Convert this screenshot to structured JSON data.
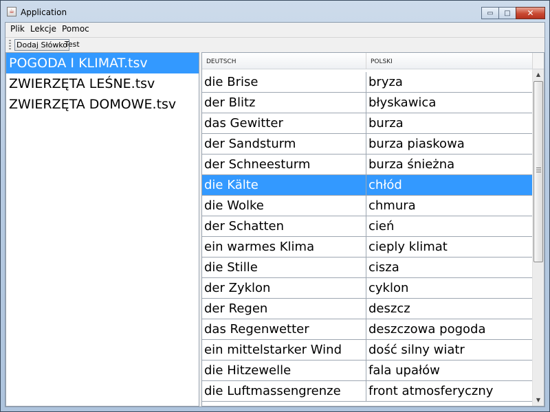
{
  "window": {
    "title": "Application",
    "close_glyph": "✕",
    "minimize_glyph": "▭",
    "maximize_glyph": "□",
    "icon": "java-app-icon"
  },
  "menu": {
    "items": [
      "Plik",
      "Lekcje",
      "Pomoc"
    ]
  },
  "toolbar": {
    "buttons": [
      "Dodaj Słówko",
      "Test"
    ]
  },
  "files": [
    {
      "name": "POGODA I KLIMAT.tsv",
      "selected": true
    },
    {
      "name": "ZWIERZĘTA LEŚNE.tsv",
      "selected": false
    },
    {
      "name": "ZWIERZĘTA DOMOWE.tsv",
      "selected": false
    }
  ],
  "table": {
    "headers": [
      "DEUTSCH",
      "POLSKI"
    ],
    "rows": [
      [
        "die Brise",
        "bryza"
      ],
      [
        "der Blitz",
        "błyskawica"
      ],
      [
        "das Gewitter",
        "burza"
      ],
      [
        "der Sandsturm",
        "burza piaskowa"
      ],
      [
        "der Schneesturm",
        "burza śnieżna"
      ],
      [
        "die Kälte",
        "chłód"
      ],
      [
        "die Wolke",
        "chmura"
      ],
      [
        "der Schatten",
        "cień"
      ],
      [
        "ein warmes Klima",
        "cieply klimat"
      ],
      [
        "die Stille",
        "cisza"
      ],
      [
        "der Zyklon",
        "cyklon"
      ],
      [
        "der Regen",
        "deszcz"
      ],
      [
        "das Regenwetter",
        "deszczowa pogoda"
      ],
      [
        "ein mittelstarker Wind",
        "dość silny wiatr"
      ],
      [
        "die Hitzewelle",
        "fala upałów"
      ],
      [
        "die Luftmassengrenze",
        "front atmosferyczny"
      ]
    ],
    "selected_row": 5
  },
  "colors": {
    "selection": "#3399ff",
    "title_gradient": "#b7cbe2",
    "close_button": "#c94a33"
  }
}
